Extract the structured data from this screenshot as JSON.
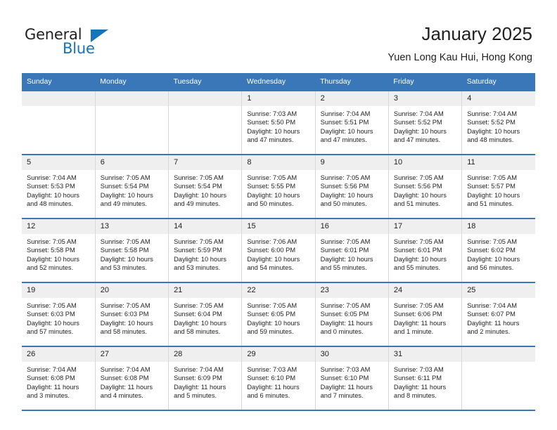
{
  "logo": {
    "primary_text": "General",
    "secondary_text": "Blue",
    "triangle_icon": "triangle-icon",
    "primary_color": "#231f20",
    "accent_color": "#1574bb"
  },
  "header": {
    "title": "January 2025",
    "subtitle": "Yuen Long Kau Hui, Hong Kong"
  },
  "theme": {
    "header_bg": "#3a77b8",
    "daynum_bg": "#efefef",
    "cell_bg": "#ffffff",
    "text_color": "#231f20"
  },
  "calendar": {
    "weekday_headers": [
      "Sunday",
      "Monday",
      "Tuesday",
      "Wednesday",
      "Thursday",
      "Friday",
      "Saturday"
    ],
    "weeks": [
      [
        {
          "day": "",
          "blank": true
        },
        {
          "day": "",
          "blank": true
        },
        {
          "day": "",
          "blank": true
        },
        {
          "day": "1",
          "sunrise": "Sunrise: 7:03 AM",
          "sunset": "Sunset: 5:50 PM",
          "daylight": "Daylight: 10 hours and 47 minutes."
        },
        {
          "day": "2",
          "sunrise": "Sunrise: 7:04 AM",
          "sunset": "Sunset: 5:51 PM",
          "daylight": "Daylight: 10 hours and 47 minutes."
        },
        {
          "day": "3",
          "sunrise": "Sunrise: 7:04 AM",
          "sunset": "Sunset: 5:52 PM",
          "daylight": "Daylight: 10 hours and 47 minutes."
        },
        {
          "day": "4",
          "sunrise": "Sunrise: 7:04 AM",
          "sunset": "Sunset: 5:52 PM",
          "daylight": "Daylight: 10 hours and 48 minutes."
        }
      ],
      [
        {
          "day": "5",
          "sunrise": "Sunrise: 7:04 AM",
          "sunset": "Sunset: 5:53 PM",
          "daylight": "Daylight: 10 hours and 48 minutes."
        },
        {
          "day": "6",
          "sunrise": "Sunrise: 7:05 AM",
          "sunset": "Sunset: 5:54 PM",
          "daylight": "Daylight: 10 hours and 49 minutes."
        },
        {
          "day": "7",
          "sunrise": "Sunrise: 7:05 AM",
          "sunset": "Sunset: 5:54 PM",
          "daylight": "Daylight: 10 hours and 49 minutes."
        },
        {
          "day": "8",
          "sunrise": "Sunrise: 7:05 AM",
          "sunset": "Sunset: 5:55 PM",
          "daylight": "Daylight: 10 hours and 50 minutes."
        },
        {
          "day": "9",
          "sunrise": "Sunrise: 7:05 AM",
          "sunset": "Sunset: 5:56 PM",
          "daylight": "Daylight: 10 hours and 50 minutes."
        },
        {
          "day": "10",
          "sunrise": "Sunrise: 7:05 AM",
          "sunset": "Sunset: 5:56 PM",
          "daylight": "Daylight: 10 hours and 51 minutes."
        },
        {
          "day": "11",
          "sunrise": "Sunrise: 7:05 AM",
          "sunset": "Sunset: 5:57 PM",
          "daylight": "Daylight: 10 hours and 51 minutes."
        }
      ],
      [
        {
          "day": "12",
          "sunrise": "Sunrise: 7:05 AM",
          "sunset": "Sunset: 5:58 PM",
          "daylight": "Daylight: 10 hours and 52 minutes."
        },
        {
          "day": "13",
          "sunrise": "Sunrise: 7:05 AM",
          "sunset": "Sunset: 5:58 PM",
          "daylight": "Daylight: 10 hours and 53 minutes."
        },
        {
          "day": "14",
          "sunrise": "Sunrise: 7:05 AM",
          "sunset": "Sunset: 5:59 PM",
          "daylight": "Daylight: 10 hours and 53 minutes."
        },
        {
          "day": "15",
          "sunrise": "Sunrise: 7:06 AM",
          "sunset": "Sunset: 6:00 PM",
          "daylight": "Daylight: 10 hours and 54 minutes."
        },
        {
          "day": "16",
          "sunrise": "Sunrise: 7:05 AM",
          "sunset": "Sunset: 6:01 PM",
          "daylight": "Daylight: 10 hours and 55 minutes."
        },
        {
          "day": "17",
          "sunrise": "Sunrise: 7:05 AM",
          "sunset": "Sunset: 6:01 PM",
          "daylight": "Daylight: 10 hours and 55 minutes."
        },
        {
          "day": "18",
          "sunrise": "Sunrise: 7:05 AM",
          "sunset": "Sunset: 6:02 PM",
          "daylight": "Daylight: 10 hours and 56 minutes."
        }
      ],
      [
        {
          "day": "19",
          "sunrise": "Sunrise: 7:05 AM",
          "sunset": "Sunset: 6:03 PM",
          "daylight": "Daylight: 10 hours and 57 minutes."
        },
        {
          "day": "20",
          "sunrise": "Sunrise: 7:05 AM",
          "sunset": "Sunset: 6:03 PM",
          "daylight": "Daylight: 10 hours and 58 minutes."
        },
        {
          "day": "21",
          "sunrise": "Sunrise: 7:05 AM",
          "sunset": "Sunset: 6:04 PM",
          "daylight": "Daylight: 10 hours and 58 minutes."
        },
        {
          "day": "22",
          "sunrise": "Sunrise: 7:05 AM",
          "sunset": "Sunset: 6:05 PM",
          "daylight": "Daylight: 10 hours and 59 minutes."
        },
        {
          "day": "23",
          "sunrise": "Sunrise: 7:05 AM",
          "sunset": "Sunset: 6:05 PM",
          "daylight": "Daylight: 11 hours and 0 minutes."
        },
        {
          "day": "24",
          "sunrise": "Sunrise: 7:05 AM",
          "sunset": "Sunset: 6:06 PM",
          "daylight": "Daylight: 11 hours and 1 minute."
        },
        {
          "day": "25",
          "sunrise": "Sunrise: 7:04 AM",
          "sunset": "Sunset: 6:07 PM",
          "daylight": "Daylight: 11 hours and 2 minutes."
        }
      ],
      [
        {
          "day": "26",
          "sunrise": "Sunrise: 7:04 AM",
          "sunset": "Sunset: 6:08 PM",
          "daylight": "Daylight: 11 hours and 3 minutes."
        },
        {
          "day": "27",
          "sunrise": "Sunrise: 7:04 AM",
          "sunset": "Sunset: 6:08 PM",
          "daylight": "Daylight: 11 hours and 4 minutes."
        },
        {
          "day": "28",
          "sunrise": "Sunrise: 7:04 AM",
          "sunset": "Sunset: 6:09 PM",
          "daylight": "Daylight: 11 hours and 5 minutes."
        },
        {
          "day": "29",
          "sunrise": "Sunrise: 7:03 AM",
          "sunset": "Sunset: 6:10 PM",
          "daylight": "Daylight: 11 hours and 6 minutes."
        },
        {
          "day": "30",
          "sunrise": "Sunrise: 7:03 AM",
          "sunset": "Sunset: 6:10 PM",
          "daylight": "Daylight: 11 hours and 7 minutes."
        },
        {
          "day": "31",
          "sunrise": "Sunrise: 7:03 AM",
          "sunset": "Sunset: 6:11 PM",
          "daylight": "Daylight: 11 hours and 8 minutes."
        },
        {
          "day": "",
          "blank": true
        }
      ]
    ]
  }
}
